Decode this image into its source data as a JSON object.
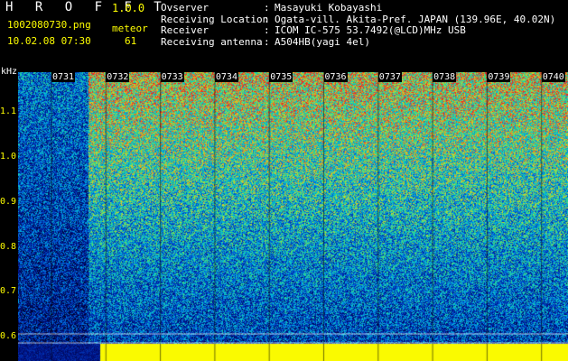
{
  "header": {
    "logo": "H R O F F T",
    "version": "1.0.0",
    "filename": "1002080730.png",
    "datetime": "10.02.08 07:30",
    "meteor_label": "meteor",
    "meteor_count": "61"
  },
  "info": [
    {
      "key": "Ovserver",
      "value": "Masayuki Kobayashi"
    },
    {
      "key": "Receiving Location",
      "value": "Ogata-vill. Akita-Pref. JAPAN (139.96E, 40.02N)"
    },
    {
      "key": "Receiver",
      "value": "ICOM IC-575 53.7492(@LCD)MHz USB"
    },
    {
      "key": "Receiving antenna",
      "value": "A504HB(yagi 4el)"
    }
  ],
  "axis": {
    "unit": "kHz",
    "y_ticks": [
      "1.1",
      "1.0",
      "0.9",
      "0.8",
      "0.7",
      "0.6"
    ],
    "x_ticks": [
      "0731",
      "0732",
      "0733",
      "0734",
      "0735",
      "0736",
      "0737",
      "0738",
      "0739",
      "0740"
    ]
  },
  "colors": {
    "header_text": "#ffff00",
    "label_text": "#ffffff",
    "background": "#000000"
  }
}
